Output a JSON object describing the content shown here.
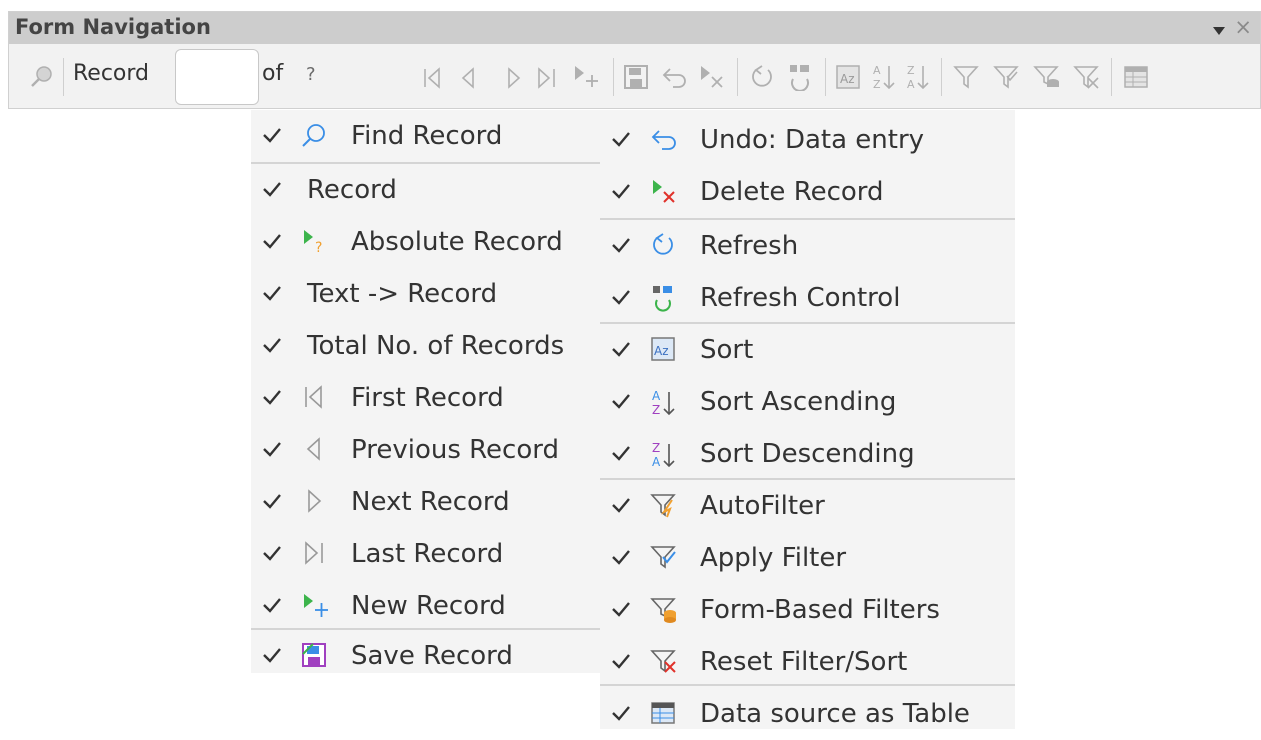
{
  "toolbar": {
    "title": "Form Navigation",
    "record_label": "Record",
    "record_value": "",
    "of_label": "of",
    "total_value": "?",
    "icons": [
      "find-record-icon",
      "first-record-icon",
      "previous-record-icon",
      "next-record-icon",
      "last-record-icon",
      "new-record-icon",
      "save-record-icon",
      "undo-icon",
      "delete-record-icon",
      "refresh-icon",
      "refresh-control-icon",
      "sort-icon",
      "sort-ascending-icon",
      "sort-descending-icon",
      "autofilter-icon",
      "apply-filter-icon",
      "form-based-filters-icon",
      "reset-filter-icon",
      "data-source-as-table-icon"
    ]
  },
  "menu_left": {
    "items": [
      {
        "label": "Find Record",
        "checked": true,
        "icon": "find-record-icon"
      },
      {
        "label": "Record",
        "checked": true,
        "icon": null
      },
      {
        "label": "Absolute Record",
        "checked": true,
        "icon": "absolute-record-icon"
      },
      {
        "label": "Text -> Record",
        "checked": true,
        "icon": null
      },
      {
        "label": "Total No. of Records",
        "checked": true,
        "icon": null
      },
      {
        "label": "First Record",
        "checked": true,
        "icon": "first-record-icon"
      },
      {
        "label": "Previous Record",
        "checked": true,
        "icon": "previous-record-icon"
      },
      {
        "label": "Next Record",
        "checked": true,
        "icon": "next-record-icon"
      },
      {
        "label": "Last Record",
        "checked": true,
        "icon": "last-record-icon"
      },
      {
        "label": "New Record",
        "checked": true,
        "icon": "new-record-icon"
      },
      {
        "label": "Save Record",
        "checked": true,
        "icon": "save-record-icon"
      }
    ]
  },
  "menu_right": {
    "items": [
      {
        "label": "Undo: Data entry",
        "checked": true,
        "icon": "undo-icon"
      },
      {
        "label": "Delete Record",
        "checked": true,
        "icon": "delete-record-icon"
      },
      {
        "label": "Refresh",
        "checked": true,
        "icon": "refresh-icon"
      },
      {
        "label": "Refresh Control",
        "checked": true,
        "icon": "refresh-control-icon"
      },
      {
        "label": "Sort",
        "checked": true,
        "icon": "sort-icon"
      },
      {
        "label": "Sort Ascending",
        "checked": true,
        "icon": "sort-ascending-icon"
      },
      {
        "label": "Sort Descending",
        "checked": true,
        "icon": "sort-descending-icon"
      },
      {
        "label": "AutoFilter",
        "checked": true,
        "icon": "autofilter-icon"
      },
      {
        "label": "Apply Filter",
        "checked": true,
        "icon": "apply-filter-icon"
      },
      {
        "label": "Form-Based Filters",
        "checked": true,
        "icon": "form-based-filters-icon"
      },
      {
        "label": "Reset Filter/Sort",
        "checked": true,
        "icon": "reset-filter-icon"
      },
      {
        "label": "Data source as Table",
        "checked": true,
        "icon": "data-source-as-table-icon"
      }
    ]
  },
  "colors": {
    "title_bar": "#cdcdcd",
    "toolbar_bg": "#f2f2f2",
    "menu_bg": "#f4f4f4",
    "accent_blue": "#3a8ee6",
    "accent_green": "#3cb44b",
    "accent_red": "#e0322b",
    "accent_orange": "#f0a030",
    "accent_purple": "#a040c0"
  }
}
